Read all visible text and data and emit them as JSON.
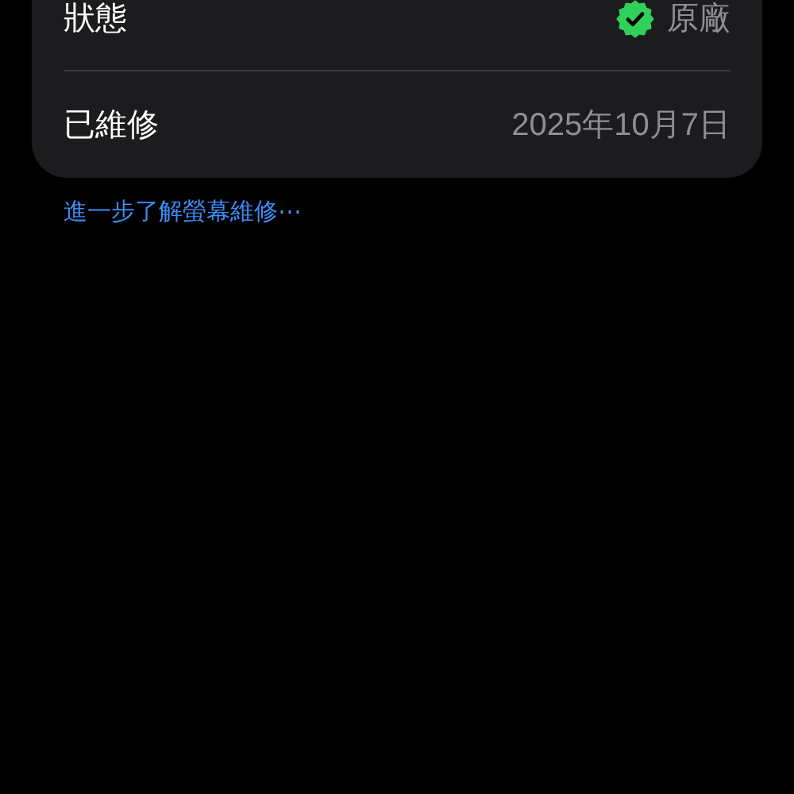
{
  "rows": [
    {
      "label": "狀態",
      "value": "原廠",
      "kind": "verified"
    },
    {
      "label": "已維修",
      "value": "2025年10月7日",
      "kind": "plain"
    }
  ],
  "link": "進一步了解螢幕維修⋯"
}
